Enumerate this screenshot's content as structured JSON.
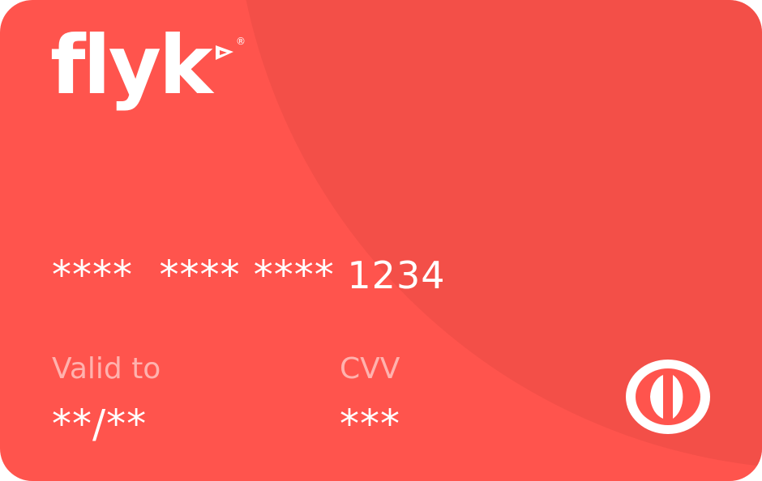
{
  "brand": {
    "name": "flyk",
    "registered_mark": "®",
    "logo_icon": "flag-arrow-icon"
  },
  "card": {
    "number_masked": "****  **** ****",
    "number_last4": "1234",
    "valid_to_label": "Valid to",
    "valid_to_value": "**/**",
    "cvv_label": "CVV",
    "cvv_value": "***",
    "network_icon": "diners-club-icon"
  },
  "colors": {
    "card_background": "#ff544d",
    "card_arc": "#ea4b45",
    "text": "#ffffff",
    "label_text": "rgba(255,255,255,0.55)"
  }
}
